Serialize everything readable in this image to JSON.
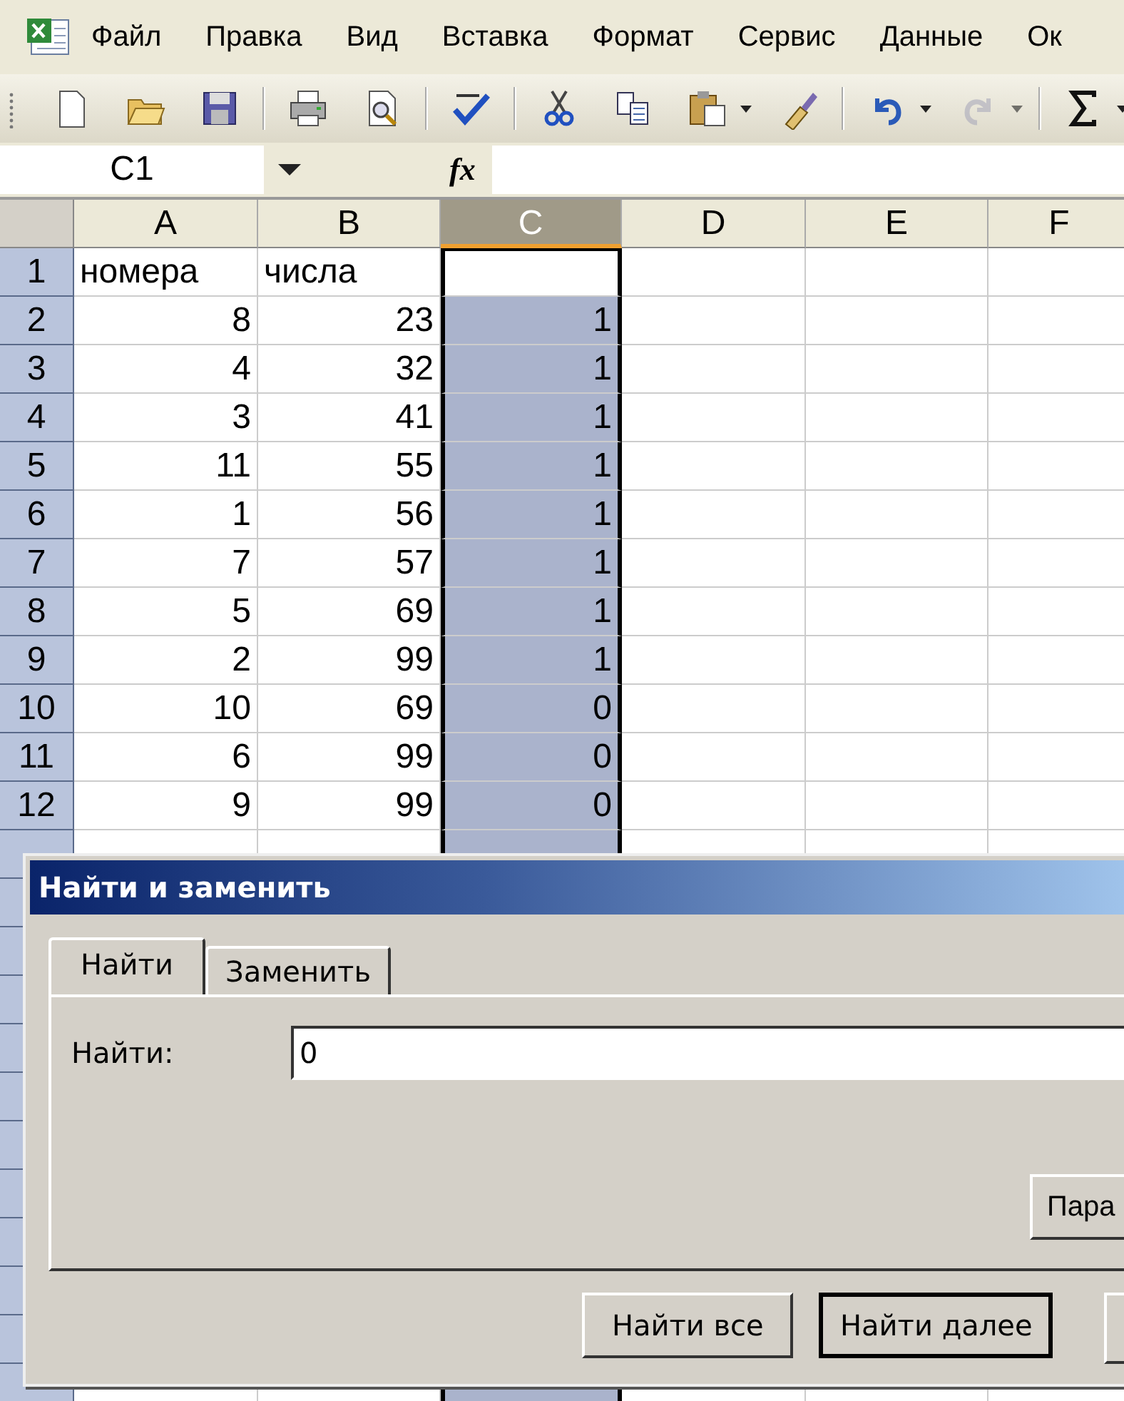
{
  "menu": [
    {
      "label": "Файл"
    },
    {
      "label": "Правка"
    },
    {
      "label": "Вид"
    },
    {
      "label": "Вставка"
    },
    {
      "label": "Формат"
    },
    {
      "label": "Сервис"
    },
    {
      "label": "Данные"
    },
    {
      "label": "Ок"
    }
  ],
  "toolbar": [
    {
      "kind": "new"
    },
    {
      "kind": "open"
    },
    {
      "kind": "save"
    },
    {
      "kind": "sep"
    },
    {
      "kind": "print"
    },
    {
      "kind": "preview"
    },
    {
      "kind": "sep"
    },
    {
      "kind": "spell"
    },
    {
      "kind": "sep"
    },
    {
      "kind": "cut"
    },
    {
      "kind": "copy"
    },
    {
      "kind": "paste"
    },
    {
      "kind": "drop"
    },
    {
      "kind": "painter"
    },
    {
      "kind": "sep"
    },
    {
      "kind": "undo",
      "disabled": false
    },
    {
      "kind": "drop",
      "disabled": false
    },
    {
      "kind": "redo",
      "disabled": true
    },
    {
      "kind": "drop",
      "disabled": true
    },
    {
      "kind": "sep"
    },
    {
      "kind": "sum"
    },
    {
      "kind": "drop"
    }
  ],
  "formula_bar": {
    "name_box": "C1",
    "function_label": "fx"
  },
  "columns": [
    {
      "label": "A",
      "selected": false
    },
    {
      "label": "B",
      "selected": false
    },
    {
      "label": "C",
      "selected": true
    },
    {
      "label": "D",
      "selected": false
    },
    {
      "label": "E",
      "selected": false
    },
    {
      "label": "F",
      "selected": false
    }
  ],
  "rows": [
    {
      "header": "1",
      "kind": "text",
      "cells": {
        "A": "номера",
        "B": "числа"
      }
    },
    {
      "header": "2",
      "kind": "number",
      "cells": {
        "A": "8",
        "B": "23",
        "C": "1"
      }
    },
    {
      "header": "3",
      "kind": "number",
      "cells": {
        "A": "4",
        "B": "32",
        "C": "1"
      }
    },
    {
      "header": "4",
      "kind": "number",
      "cells": {
        "A": "3",
        "B": "41",
        "C": "1"
      }
    },
    {
      "header": "5",
      "kind": "number",
      "cells": {
        "A": "11",
        "B": "55",
        "C": "1"
      }
    },
    {
      "header": "6",
      "kind": "number",
      "cells": {
        "A": "1",
        "B": "56",
        "C": "1"
      }
    },
    {
      "header": "7",
      "kind": "number",
      "cells": {
        "A": "7",
        "B": "57",
        "C": "1"
      }
    },
    {
      "header": "8",
      "kind": "number",
      "cells": {
        "A": "5",
        "B": "69",
        "C": "1"
      }
    },
    {
      "header": "9",
      "kind": "number",
      "cells": {
        "A": "2",
        "B": "99",
        "C": "1"
      }
    },
    {
      "header": "10",
      "kind": "number",
      "cells": {
        "A": "10",
        "B": "69",
        "C": "0"
      }
    },
    {
      "header": "11",
      "kind": "number",
      "cells": {
        "A": "6",
        "B": "99",
        "C": "0"
      }
    },
    {
      "header": "12",
      "kind": "number",
      "cells": {
        "A": "9",
        "B": "99",
        "C": "0"
      }
    }
  ],
  "dialog": {
    "title": "Найти и заменить",
    "tabs": [
      {
        "label": "Найти",
        "selected": true
      },
      {
        "label": "Заменить",
        "selected": false
      }
    ],
    "find_label": "Найти:",
    "find_value": "0",
    "options_button": "Пара",
    "buttons": [
      {
        "label": "Найти все",
        "default": false
      },
      {
        "label": "Найти далее",
        "default": true
      }
    ]
  }
}
